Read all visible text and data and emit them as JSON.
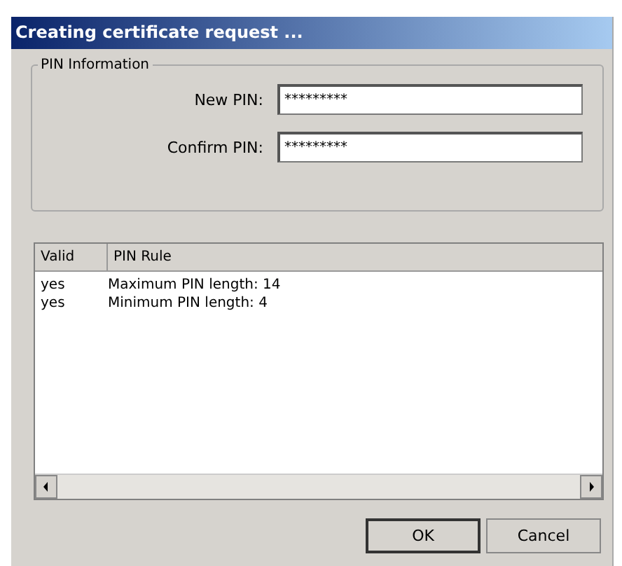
{
  "window": {
    "title": "Creating certificate request ..."
  },
  "pin_information": {
    "title": "PIN Information",
    "fields": [
      {
        "label": "New PIN:",
        "value": "*********"
      },
      {
        "label": "Confirm PIN:",
        "value": "*********"
      }
    ]
  },
  "table": {
    "columns": [
      "Valid",
      "PIN Rule"
    ],
    "rows": [
      [
        "yes",
        "Maximum PIN length: 14"
      ],
      [
        "yes",
        "Minimum PIN length: 4"
      ]
    ]
  },
  "buttons": [
    {
      "label": "OK",
      "default": true
    },
    {
      "label": "Cancel",
      "default": false
    }
  ]
}
